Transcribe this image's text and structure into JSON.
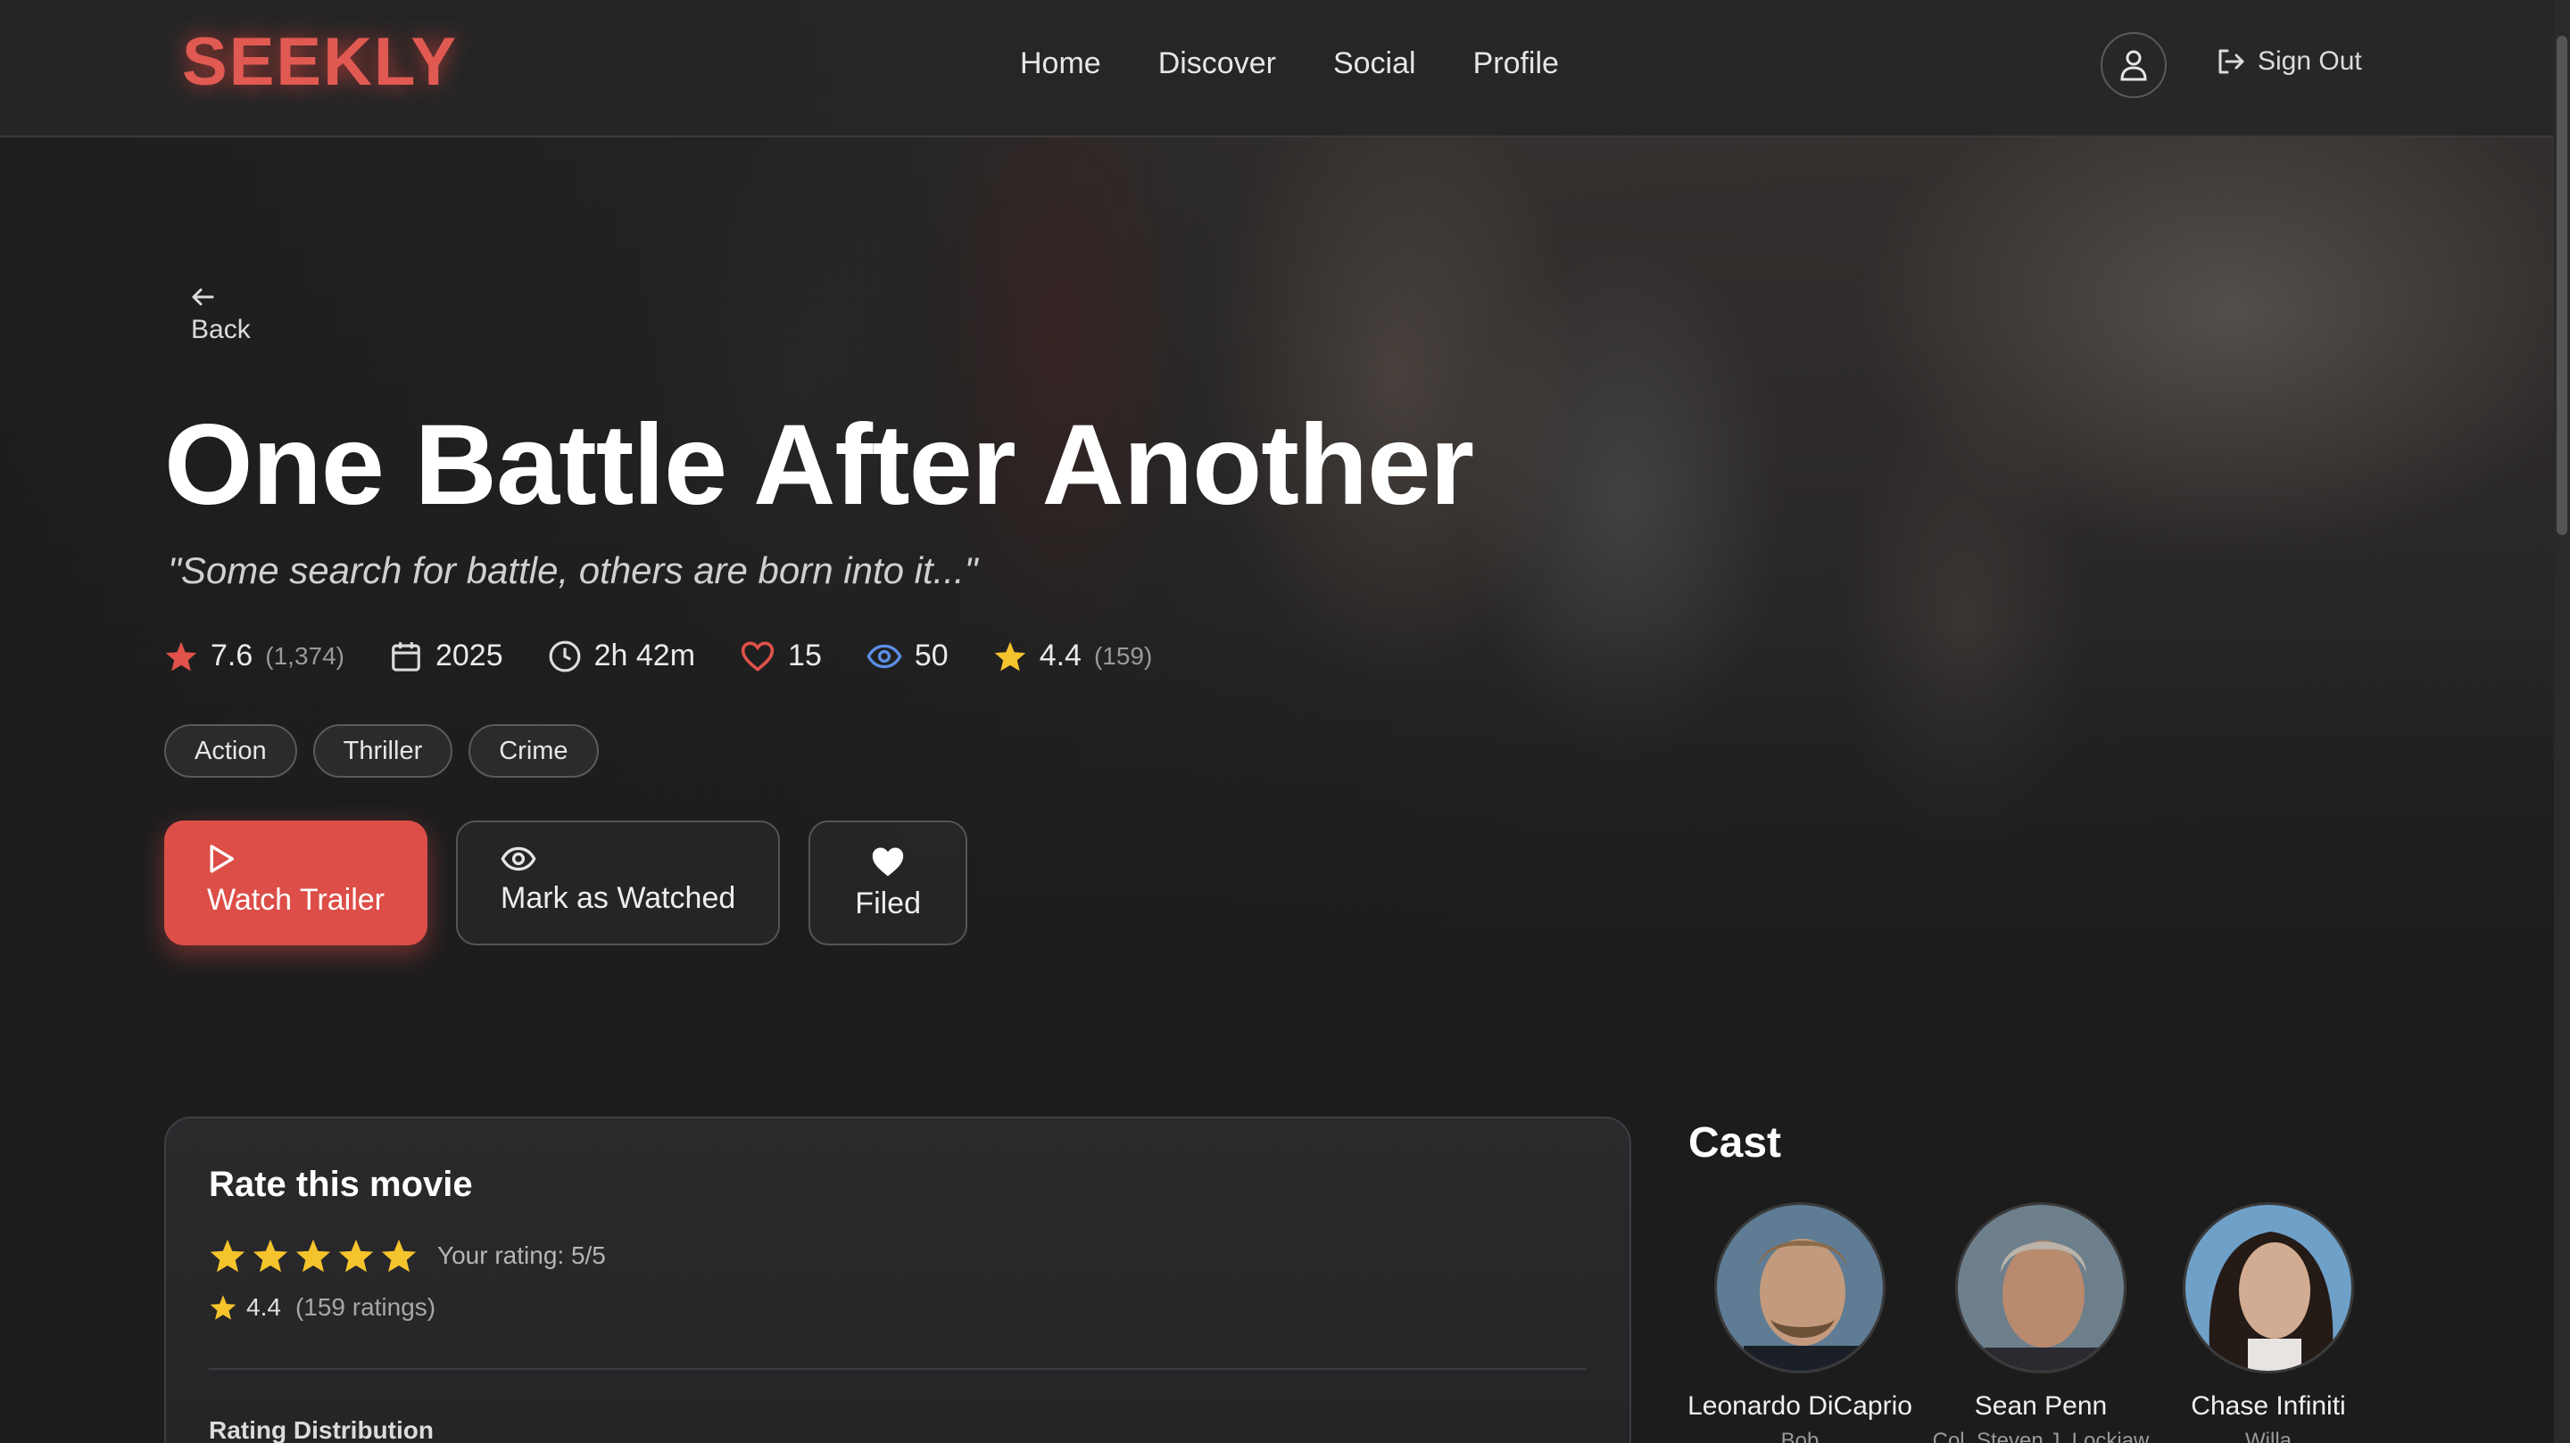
{
  "brand": {
    "logo": "SEEKLY"
  },
  "nav": {
    "links": [
      "Home",
      "Discover",
      "Social",
      "Profile"
    ],
    "sign_out_label": "Sign Out",
    "user_icon": "user-icon",
    "sign_out_icon": "logout-icon"
  },
  "back": {
    "label": "Back",
    "icon": "arrow-left-icon"
  },
  "movie": {
    "title": "One Battle After Another",
    "tagline": "\"Some search for battle, others are born into it...\"",
    "meta": {
      "rating": "7.6",
      "rating_count": "(1,374)",
      "year": "2025",
      "runtime": "2h 42m",
      "likes": "15",
      "views": "50",
      "user_rating": "4.4",
      "user_rating_count": "(159)"
    },
    "genres": [
      "Action",
      "Thriller",
      "Crime"
    ]
  },
  "actions": {
    "watch_trailer": "Watch Trailer",
    "mark_watched": "Mark as Watched",
    "filed": "Filed"
  },
  "rate": {
    "title": "Rate this movie",
    "your_rating": "Your rating: 5/5",
    "selected_stars": 5,
    "average": "4.4",
    "count": "(159 ratings)",
    "distribution_label": "Rating Distribution"
  },
  "cast": {
    "title": "Cast",
    "members": [
      {
        "name": "Leonardo DiCaprio",
        "role": "Bob"
      },
      {
        "name": "Sean Penn",
        "role": "Col. Steven J. Lockjaw"
      },
      {
        "name": "Chase Infiniti",
        "role": "Willa"
      }
    ]
  },
  "colors": {
    "accent": "#dc4e47",
    "logo": "#e05a52",
    "star": "#f5c42c",
    "heart": "#e0524a",
    "eye": "#5b8fe6",
    "rating_star": "#e0524a"
  }
}
